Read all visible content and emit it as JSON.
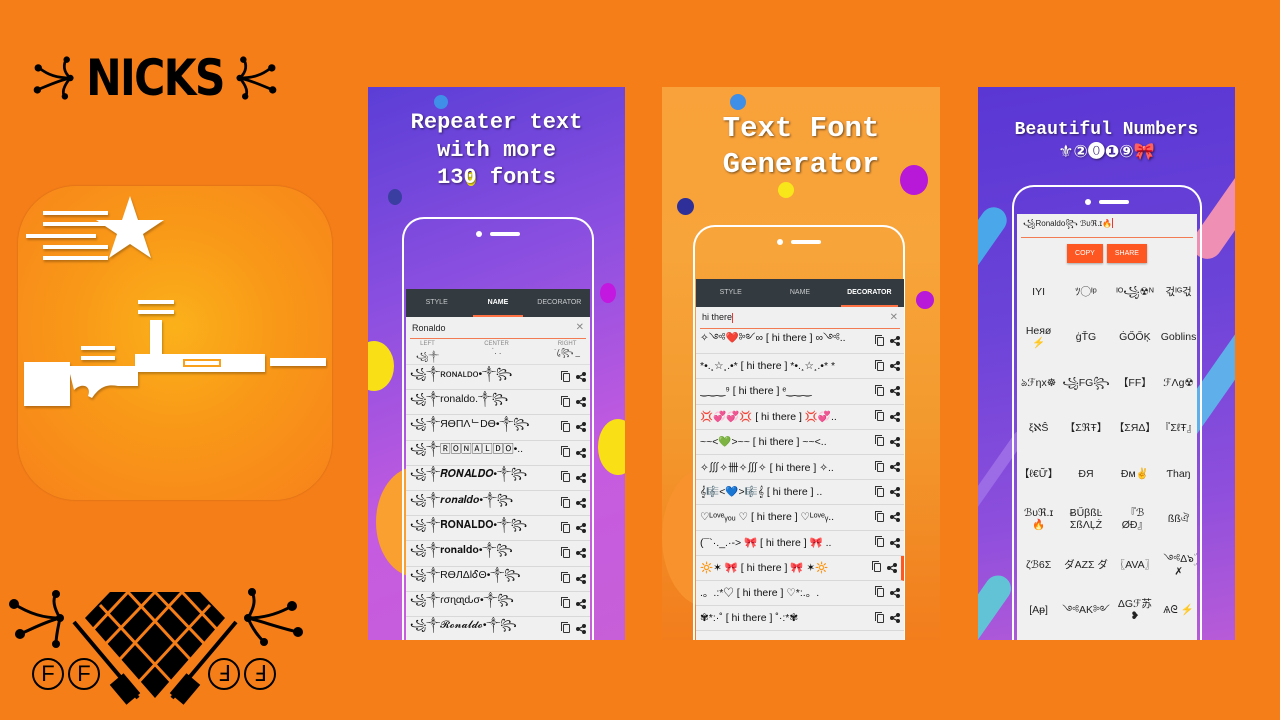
{
  "logo": {
    "text": "NICKS"
  },
  "bottom_logo": {
    "left_letters": [
      "F",
      "F"
    ],
    "right_letters": [
      "Ⅎ",
      "Ⅎ"
    ]
  },
  "colors": {
    "background": "#f67e18",
    "accent": "#ff5722",
    "tabbar": "#333a40"
  },
  "screenshots": [
    {
      "headline": [
        "Repeater text",
        "with more",
        "130 fonts"
      ],
      "tabs": [
        {
          "label": "STYLE",
          "active": false
        },
        {
          "label": "NAME",
          "active": true
        },
        {
          "label": "DECORATOR",
          "active": false
        }
      ],
      "input_value": "Ronaldo",
      "align_labels": [
        "LEFT",
        "CENTER",
        "RIGHT"
      ],
      "align_values": [
        "꧁༒",
        "˙.  .",
        "˙.ꦿ꧂ _"
      ],
      "rows": [
        "꧁༒ʀᴏɴᴀʟᴅᴏ•༒꧂",
        "꧁༒ronaldo.༒꧂",
        "꧁༒ЯӨПΛᄂDӨ•༒꧂",
        "꧁༒🅁🄾🄽🄰🄻🄳🄾•..",
        "꧁༒𝑹𝑶𝑵𝑨𝑳𝑫𝑶•༒꧂",
        "꧁༒𝒓𝒐𝒏𝒂𝒍𝒅𝒐•༒꧂",
        "꧁༒𝐑𝐎𝐍𝐀𝐋𝐃𝐎•༒꧂",
        "꧁༒𝐫𝐨𝐧𝐚𝐥𝐝𝐨•༒꧂",
        "꧁༒RӨЛΔlᎴΘ•༒꧂",
        "꧁༒ɾσɳαʅԃσ•༒꧂",
        "꧁༒𝓡𝓸𝓷𝓪𝓵𝓭𝓸•༒꧂"
      ]
    },
    {
      "headline": [
        "Text Font",
        "Generator"
      ],
      "tabs": [
        {
          "label": "STYLE",
          "active": false
        },
        {
          "label": "NAME",
          "active": false
        },
        {
          "label": "DECORATOR",
          "active": true
        }
      ],
      "input_value": "hi there",
      "rows": [
        "✧༺❤️༻∞ [ hi there ] ∞༺..",
        "*•.¸☆¸.•*  [ hi there ] *•.¸☆¸.•* *",
        "‿‿‿⁹ [ hi there ] ᵉ‿‿‿",
        "💢💞💞💢 [ hi there ] 💢💞..",
        "~~<💚>~~ [ hi there ] ~~<..",
        "✧∭✧卌✧∭✧ [ hi there ] ✧..",
        "𝄞🎼<💙>🎼𝄞 [ hi there ] ..",
        "♡ᴸᵒᵛᵉᵧₒᵤ ♡ [ hi there ] ♡ᴸᵒᵛᵉᵧ..",
        "(¯`·._.·-> 🎀 [ hi there ] 🎀 ..",
        "🔆✶ 🎀 [ hi there ] 🎀 ✶🔆",
        ".。.:*♡ [ hi there ] ♡*:.。.",
        "✾*:·˚ [ hi there ] ˚·:*✾"
      ]
    },
    {
      "headline": [
        "Beautiful Numbers",
        "⚜②⓿❶⑨🎀"
      ],
      "input_value": "꧁Ronaldo꧂ ℬᴜℜ.ɪ🔥",
      "copy_label": "COPY",
      "share_label": "SHARE",
      "grid": [
        "ΙΥΙ",
        "ﾂ◯ᴵᵖ",
        "ᴵᴼ꧁☢ᴺ",
        "걳ᴵᴳ걳",
        "Heяø ⚡",
        "ġŤG",
        "ĠŐŐĶ",
        "Goblins",
        "ঌℱηx☸",
        "꧁FG꧂",
        "【FF】",
        "ℱΛɡ☢",
        "ξℵŜ",
        "【ΣℜŦ】",
        "【ΣЯΔ】",
        "『ΣℓŦ』",
        "【ℓ€Ữ】",
        "ÐЯ",
        "Ðм✌",
        "Ƭhaŋ",
        "ℬᴜℜ.ɪ 🔥",
        "ɃŰβßĿ ΣßΛĻŻ",
        "『ℬ ØÐ』",
        "ßßঐ",
        "ζℬ6Σ",
        "ダAZΣ ダ",
        "〖AVA〗",
        "༺Δ๖ۣۜ ✗",
        "[Aᵽ]",
        "༺AK༻",
        "ΔGℱ苏 ❥",
        "Ѧᘓ ⚡"
      ]
    }
  ]
}
